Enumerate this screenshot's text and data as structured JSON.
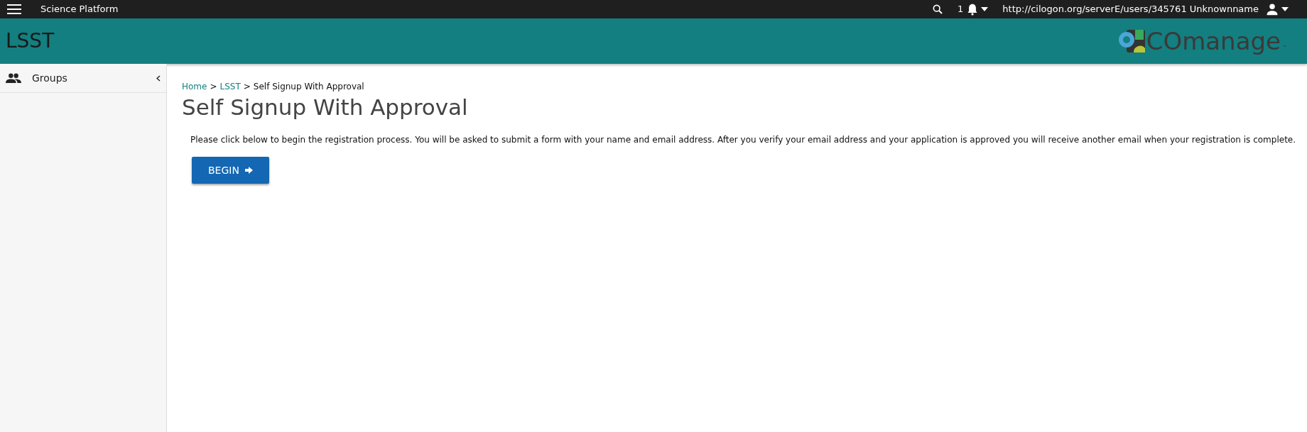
{
  "top_bar": {
    "app_name": "Science Platform",
    "notification_count": "1",
    "user": "http://cilogon.org/serverE/users/345761 Unknownname"
  },
  "header": {
    "title": "LSST",
    "logo_text": "COmanage",
    "logo_mark": "™"
  },
  "sidebar": {
    "items": [
      {
        "label": "Groups",
        "expanded": false
      }
    ]
  },
  "breadcrumb_separator": ">",
  "breadcrumb": [
    {
      "label": "Home",
      "kind": "link"
    },
    {
      "label": "LSST",
      "kind": "link"
    },
    {
      "label": "Self Signup With Approval",
      "kind": "current"
    }
  ],
  "page_title": "Self Signup With Approval",
  "intro": "Please click below to begin the registration process. You will be asked to submit a form with your name and email address. After you verify your email address and your application is approved you will receive another email when your registration is complete.",
  "begin_button": "BEGIN"
}
